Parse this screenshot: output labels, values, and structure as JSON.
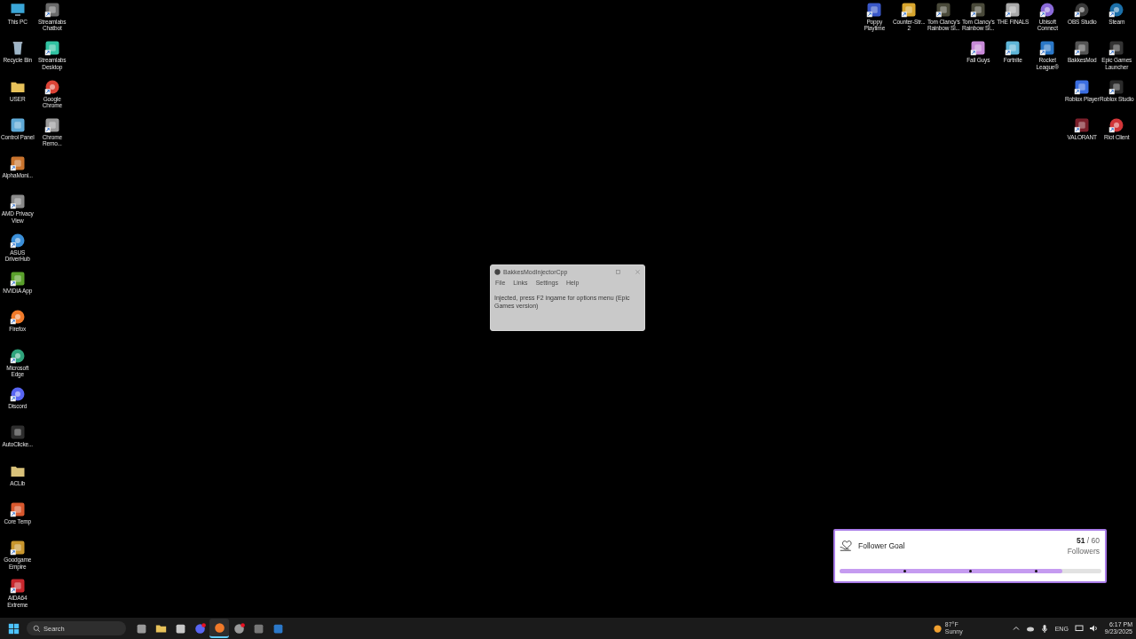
{
  "desktop_left": [
    [
      {
        "label": "This PC",
        "kind": "monitor",
        "color": "#3aa6d8",
        "shortcut": false
      },
      {
        "label": "Recycle Bin",
        "kind": "bin",
        "color": "#9fb6c8",
        "shortcut": false
      },
      {
        "label": "USER",
        "kind": "folder",
        "color": "#e8c25a",
        "shortcut": false
      },
      {
        "label": "Control Panel",
        "kind": "tile",
        "color": "#5fa9d6",
        "shortcut": false
      },
      {
        "label": "AlphaMoni...",
        "kind": "tile",
        "color": "#c9742e",
        "shortcut": true
      },
      {
        "label": "AMD Privacy View",
        "kind": "tile",
        "color": "#8a8a8a",
        "shortcut": true
      },
      {
        "label": "ASUS DriverHub",
        "kind": "round",
        "color": "#3b8fd8",
        "shortcut": true
      },
      {
        "label": "NVIDIA App",
        "kind": "tile",
        "color": "#5aa02c",
        "shortcut": true
      },
      {
        "label": "Firefox",
        "kind": "round",
        "color": "#f07a2a",
        "shortcut": true
      },
      {
        "label": "Microsoft Edge",
        "kind": "round",
        "color": "#2fa37c",
        "shortcut": true
      },
      {
        "label": "Discord",
        "kind": "round",
        "color": "#5865f2",
        "shortcut": true
      },
      {
        "label": "AutoClicke...",
        "kind": "tile",
        "color": "#2e2e2e",
        "shortcut": false
      },
      {
        "label": "ACLib",
        "kind": "folder",
        "color": "#d9c27a",
        "shortcut": false
      },
      {
        "label": "Core Temp",
        "kind": "tile",
        "color": "#d8582e",
        "shortcut": true
      },
      {
        "label": "Goodgame Empire",
        "kind": "tile",
        "color": "#c8962e",
        "shortcut": true
      },
      {
        "label": "AIDA64 Extreme",
        "kind": "tile",
        "color": "#c8282e",
        "shortcut": true
      }
    ],
    [
      {
        "label": "Streamlabs Chatbot",
        "kind": "tile",
        "color": "#6b6b6b",
        "shortcut": true
      },
      {
        "label": "Streamlabs Desktop",
        "kind": "tile",
        "color": "#31c3a2",
        "shortcut": true
      },
      {
        "label": "Google Chrome",
        "kind": "round",
        "color": "#db4437",
        "shortcut": true
      },
      {
        "label": "Chrome Remo...",
        "kind": "tile",
        "color": "#9a9a9a",
        "shortcut": true
      }
    ]
  ],
  "desktop_right": [
    [
      {
        "label": "Poppy Playtime",
        "kind": "tile",
        "color": "#3a58c8",
        "shortcut": true
      }
    ],
    [
      {
        "label": "Counter-Str... 2",
        "kind": "tile",
        "color": "#d8a62e",
        "shortcut": true
      }
    ],
    [
      {
        "label": "Tom Clancy's Rainbow Si...",
        "kind": "tile",
        "color": "#4a4a3a",
        "shortcut": true
      }
    ],
    [
      {
        "label": "Tom Clancy's Rainbow Si...",
        "kind": "tile",
        "color": "#4a4a3a",
        "shortcut": true
      },
      {
        "label": "Fall Guys",
        "kind": "tile",
        "color": "#c88ad8",
        "shortcut": true
      }
    ],
    [
      {
        "label": "THE FINALS",
        "kind": "tile",
        "color": "#aaaaaa",
        "shortcut": true
      },
      {
        "label": "Fortnite",
        "kind": "tile",
        "color": "#5fb6d8",
        "shortcut": true
      }
    ],
    [
      {
        "label": "Ubisoft Connect",
        "kind": "round",
        "color": "#8a6ad8",
        "shortcut": true
      },
      {
        "label": "Rocket League®",
        "kind": "tile",
        "color": "#2b78c8",
        "shortcut": true
      }
    ],
    [
      {
        "label": "OBS Studio",
        "kind": "round",
        "color": "#3a3a3a",
        "shortcut": true
      },
      {
        "label": "BakkesMod",
        "kind": "tile",
        "color": "#555555",
        "shortcut": true
      },
      {
        "label": "Roblox Player",
        "kind": "tile",
        "color": "#3b6ee0",
        "shortcut": true
      },
      {
        "label": "VALORANT",
        "kind": "tile",
        "color": "#7a1f2a",
        "shortcut": true
      }
    ],
    [
      {
        "label": "Steam",
        "kind": "round",
        "color": "#1b6fa8",
        "shortcut": true
      },
      {
        "label": "Epic Games Launcher",
        "kind": "tile",
        "color": "#333333",
        "shortcut": true
      },
      {
        "label": "Roblox Studio",
        "kind": "tile",
        "color": "#2a2a2a",
        "shortcut": true
      },
      {
        "label": "Riot Client",
        "kind": "round",
        "color": "#d13639",
        "shortcut": true
      }
    ]
  ],
  "window": {
    "title": "BakkesModInjectorCpp",
    "menu": [
      "File",
      "Links",
      "Settings",
      "Help"
    ],
    "message": "Injected, press F2 ingame for options menu (Epic Games version)"
  },
  "follower_goal": {
    "title": "Follower Goal",
    "count": "**51** / 60",
    "unit": "Followers",
    "level": 0.85
  },
  "taskbar": {
    "search_placeholder": "Search",
    "apps": [
      {
        "kind": "tile",
        "color": "#9a9a9a",
        "active": false,
        "notification": false
      },
      {
        "kind": "folder",
        "color": "#e8c25a",
        "active": false,
        "notification": false
      },
      {
        "kind": "tile",
        "color": "#c8c8c8",
        "active": false,
        "notification": false
      },
      {
        "kind": "round",
        "color": "#5865f2",
        "active": false,
        "notification": true
      },
      {
        "kind": "round",
        "color": "#f07a2a",
        "active": true,
        "notification": false
      },
      {
        "kind": "round",
        "color": "#9a9a9a",
        "active": false,
        "notification": true
      },
      {
        "kind": "tile",
        "color": "#777777",
        "active": false,
        "notification": false
      },
      {
        "kind": "tile",
        "color": "#2b78c8",
        "active": false,
        "notification": false
      }
    ],
    "weather_temp": "87°F",
    "weather_text": "Sunny",
    "language": "ENG",
    "time": "6:17 PM",
    "date": "9/23/2025"
  }
}
